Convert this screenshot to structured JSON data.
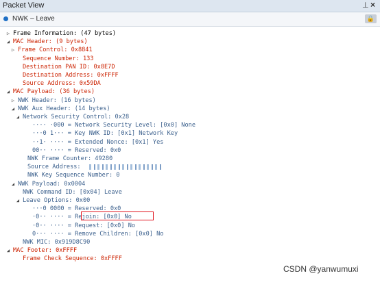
{
  "panel": {
    "title": "Packet View",
    "pin_glyph": "⊥",
    "close_glyph": "×"
  },
  "tab": {
    "label": "NWK – Leave",
    "lock_glyph": "🔒"
  },
  "tree": [
    {
      "expander": "▷",
      "text": "Frame Information: (47 bytes)",
      "color": "normal"
    },
    {
      "expander": "◢",
      "text": "MAC Header: (9 bytes)",
      "color": "red"
    },
    {
      "expander": "▷",
      "text": "Frame Control: 0x8841",
      "color": "red"
    },
    {
      "expander": "",
      "text": "Sequence Number: 133",
      "color": "red"
    },
    {
      "expander": "",
      "text": "Destination PAN ID: 0x8E7D",
      "color": "red"
    },
    {
      "expander": "",
      "text": "Destination Address: 0xFFFF",
      "color": "red"
    },
    {
      "expander": "",
      "text": "Source Address: 0x59DA",
      "color": "red"
    },
    {
      "expander": "◢",
      "text": "MAC Payload: (36 bytes)",
      "color": "red"
    },
    {
      "expander": "▷",
      "text": "NWK Header: (16 bytes)",
      "color": "blue"
    },
    {
      "expander": "◢",
      "text": "NWK Aux Header: (14 bytes)",
      "color": "blue"
    },
    {
      "expander": "◢",
      "text": "Network Security Control: 0x28",
      "color": "blue"
    },
    {
      "expander": "",
      "text": "···· ·000 = Network Security Level: [0x0] None",
      "color": "blue"
    },
    {
      "expander": "",
      "text": "···0 1··· = Key NWK ID: [0x1] Network Key",
      "color": "blue"
    },
    {
      "expander": "",
      "text": "··1· ···· = Extended Nonce: [0x1] Yes",
      "color": "blue"
    },
    {
      "expander": "",
      "text": "00·· ···· = Reserved: 0x0",
      "color": "blue"
    },
    {
      "expander": "",
      "text": "NWK Frame Counter: 49280",
      "color": "blue"
    },
    {
      "expander": "",
      "text": "Source Address: ",
      "color": "blue",
      "redacted": true
    },
    {
      "expander": "",
      "text": "NWK Key Sequence Number: 0",
      "color": "blue"
    },
    {
      "expander": "◢",
      "text": "NWK Payload: 0x0004",
      "color": "blue"
    },
    {
      "expander": "",
      "text": "NWK Command ID: [0x04] Leave",
      "color": "blue"
    },
    {
      "expander": "◢",
      "text": "Leave Options: 0x00",
      "color": "blue"
    },
    {
      "expander": "",
      "text": "···0 0000 = Reserved: 0x0",
      "color": "blue"
    },
    {
      "expander": "",
      "text": "·0·· ···· = Rejoin: [0x0] No",
      "color": "blue"
    },
    {
      "expander": "",
      "text": "·0·· ···· = Request: [0x0] No",
      "color": "blue"
    },
    {
      "expander": "",
      "text": "0··· ···· = Remove Children: [0x0] No",
      "color": "blue"
    },
    {
      "expander": "",
      "text": "NWK MIC: 0x919D8C90",
      "color": "blue"
    },
    {
      "expander": "◢",
      "text": "MAC Footer: 0xFFFF",
      "color": "red"
    },
    {
      "expander": "",
      "text": "Frame Check Sequence: 0xFFFF",
      "color": "red"
    }
  ],
  "watermark": "CSDN @yanwumuxi"
}
